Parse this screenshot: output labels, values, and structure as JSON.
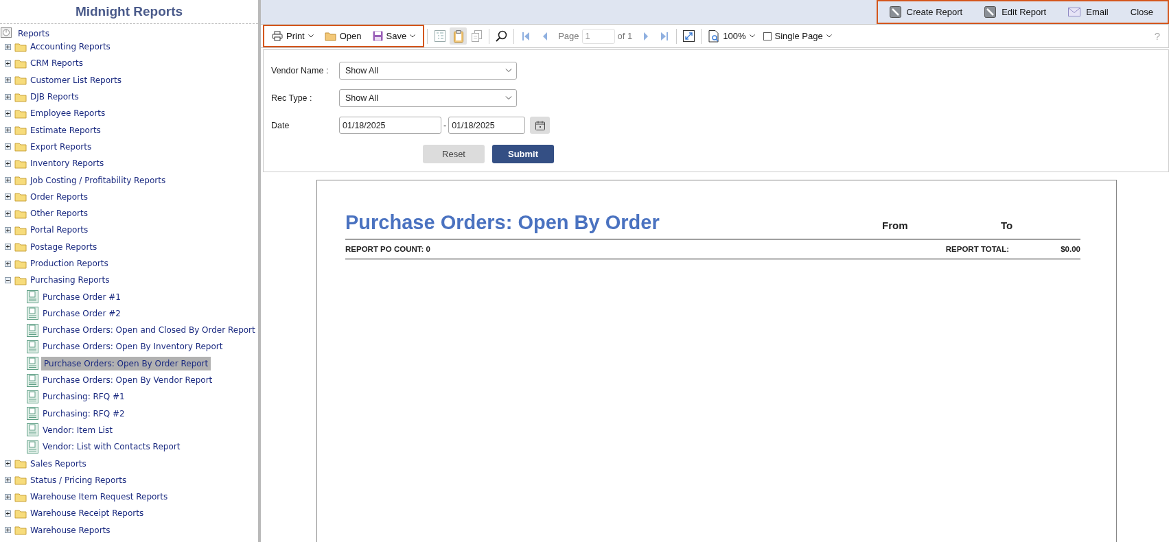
{
  "sidebar": {
    "title": "Midnight Reports",
    "tree": {
      "root": "Reports",
      "folders": [
        {
          "label": "Accounting Reports",
          "expanded": false
        },
        {
          "label": "CRM Reports",
          "expanded": false
        },
        {
          "label": "Customer List Reports",
          "expanded": false
        },
        {
          "label": "DJB Reports",
          "expanded": false
        },
        {
          "label": "Employee Reports",
          "expanded": false
        },
        {
          "label": "Estimate Reports",
          "expanded": false
        },
        {
          "label": "Export Reports",
          "expanded": false
        },
        {
          "label": "Inventory Reports",
          "expanded": false
        },
        {
          "label": "Job Costing / Profitability Reports",
          "expanded": false
        },
        {
          "label": "Order Reports",
          "expanded": false
        },
        {
          "label": "Other Reports",
          "expanded": false
        },
        {
          "label": "Portal Reports",
          "expanded": false
        },
        {
          "label": "Postage Reports",
          "expanded": false
        },
        {
          "label": "Production Reports",
          "expanded": false
        },
        {
          "label": "Purchasing Reports",
          "expanded": true,
          "children": [
            {
              "label": "Purchase Order #1",
              "selected": false
            },
            {
              "label": "Purchase Order #2",
              "selected": false
            },
            {
              "label": "Purchase Orders: Open and Closed By Order Report",
              "selected": false
            },
            {
              "label": "Purchase Orders: Open By Inventory Report",
              "selected": false
            },
            {
              "label": "Purchase Orders: Open By Order Report",
              "selected": true
            },
            {
              "label": "Purchase Orders: Open By Vendor Report",
              "selected": false
            },
            {
              "label": "Purchasing: RFQ #1",
              "selected": false
            },
            {
              "label": "Purchasing: RFQ #2",
              "selected": false
            },
            {
              "label": "Vendor: Item List",
              "selected": false
            },
            {
              "label": "Vendor: List with Contacts Report",
              "selected": false
            }
          ]
        },
        {
          "label": "Sales Reports",
          "expanded": false
        },
        {
          "label": "Status / Pricing Reports",
          "expanded": false
        },
        {
          "label": "Warehouse Item Request Reports",
          "expanded": false
        },
        {
          "label": "Warehouse Receipt Reports",
          "expanded": false
        },
        {
          "label": "Warehouse Reports",
          "expanded": false
        }
      ]
    }
  },
  "top_actions": [
    {
      "label": "Create Report",
      "kind": "pencil"
    },
    {
      "label": "Edit Report",
      "kind": "pencil"
    },
    {
      "label": "Email",
      "kind": "mail"
    },
    {
      "label": "Close",
      "kind": "text"
    }
  ],
  "toolbar": {
    "file_buttons": [
      {
        "label": "Print",
        "kind": "print",
        "dropdown": true
      },
      {
        "label": "Open",
        "kind": "folder",
        "dropdown": false
      },
      {
        "label": "Save",
        "kind": "save",
        "dropdown": true
      }
    ],
    "view_buttons": [
      {
        "kind": "tree",
        "on": false
      },
      {
        "kind": "clipboard",
        "on": true
      },
      {
        "kind": "copy",
        "on": false
      }
    ],
    "page_label": "Page",
    "page_value": "1",
    "page_of": "of 1",
    "zoom": "100%",
    "single_page": {
      "label": "Single Page",
      "checked": false
    },
    "help": "?"
  },
  "form": {
    "fields": [
      {
        "label": "Vendor Name :",
        "kind": "select",
        "value": "Show All"
      },
      {
        "label": "Rec Type :",
        "kind": "select",
        "value": "Show All"
      },
      {
        "label": "Date",
        "kind": "date_range",
        "from": "01/18/2025",
        "separator": "-",
        "to": "01/18/2025"
      }
    ],
    "buttons": [
      {
        "label": "Reset",
        "kind": "secondary"
      },
      {
        "label": "Submit",
        "kind": "primary"
      }
    ]
  },
  "report": {
    "title": "Purchase Orders: Open By Order",
    "from_label": "From",
    "to_label": "To",
    "count": "REPORT PO COUNT: 0",
    "total_label": "REPORT TOTAL:",
    "total": "$0.00"
  }
}
